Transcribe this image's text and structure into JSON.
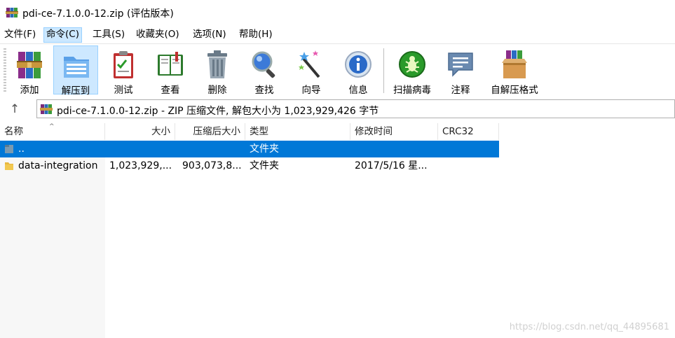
{
  "window": {
    "title": "pdi-ce-7.1.0.0-12.zip (评估版本)"
  },
  "menu": [
    "文件(F)",
    "命令(C)",
    "工具(S)",
    "收藏夹(O)",
    "选项(N)",
    "帮助(H)"
  ],
  "menu_active_index": 1,
  "toolbar": [
    {
      "label": "添加",
      "icon": "archive-books-icon"
    },
    {
      "label": "解压到",
      "icon": "extract-folder-icon"
    },
    {
      "label": "测试",
      "icon": "test-clipboard-icon"
    },
    {
      "label": "查看",
      "icon": "view-book-icon"
    },
    {
      "label": "删除",
      "icon": "trash-can-icon"
    },
    {
      "label": "查找",
      "icon": "magnifier-icon"
    },
    {
      "label": "向导",
      "icon": "magic-wand-icon"
    },
    {
      "label": "信息",
      "icon": "info-icon"
    },
    {
      "label": "扫描病毒",
      "icon": "virus-scan-icon"
    },
    {
      "label": "注释",
      "icon": "comment-icon"
    },
    {
      "label": "自解压格式",
      "icon": "sfx-box-icon"
    }
  ],
  "toolbar_pressed_index": 1,
  "address": {
    "up_glyph": "↑",
    "text": "pdi-ce-7.1.0.0-12.zip - ZIP 压缩文件, 解包大小为 1,023,929,426 字节"
  },
  "columns": [
    "名称",
    "大小",
    "压缩后大小",
    "类型",
    "修改时间",
    "CRC32"
  ],
  "sort_indicator": "^",
  "rows": [
    {
      "name": "..",
      "size": "",
      "packed": "",
      "type": "文件夹",
      "modified": "",
      "crc": "",
      "selected": true
    },
    {
      "name": "data-integration",
      "size": "1,023,929,...",
      "packed": "903,073,8...",
      "type": "文件夹",
      "modified": "2017/5/16 星...",
      "crc": "",
      "selected": false
    }
  ],
  "watermark": "https://blog.csdn.net/qq_44895681",
  "colors": {
    "selection": "#0078d7",
    "menu_active": "#cce8ff",
    "folder": "#e8b840"
  }
}
